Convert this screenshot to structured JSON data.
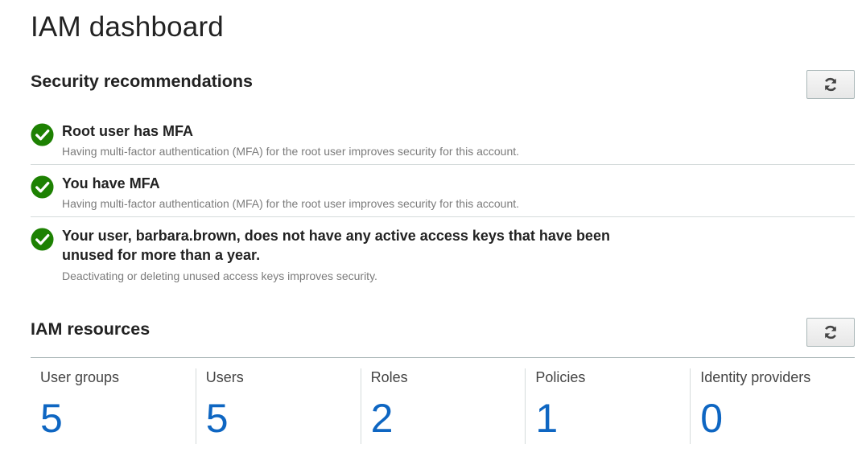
{
  "page": {
    "title": "IAM dashboard"
  },
  "security": {
    "title": "Security recommendations",
    "refresh_icon": "refresh-icon",
    "status_icon": "check-circle-icon",
    "status_color": "#1d8102",
    "items": [
      {
        "title": "Root user has MFA",
        "description": "Having multi-factor authentication (MFA) for the root user improves security for this account."
      },
      {
        "title": "You have MFA",
        "description": "Having multi-factor authentication (MFA) for the root user improves security for this account."
      },
      {
        "title": "Your user, barbara.brown, does not have any active access keys that have been unused for more than a year.",
        "description": "Deactivating or deleting unused access keys improves security."
      }
    ]
  },
  "resources": {
    "title": "IAM resources",
    "refresh_icon": "refresh-icon",
    "link_color": "#0e66c2",
    "items": [
      {
        "label": "User groups",
        "count": "5"
      },
      {
        "label": "Users",
        "count": "5"
      },
      {
        "label": "Roles",
        "count": "2"
      },
      {
        "label": "Policies",
        "count": "1"
      },
      {
        "label": "Identity providers",
        "count": "0"
      }
    ]
  }
}
